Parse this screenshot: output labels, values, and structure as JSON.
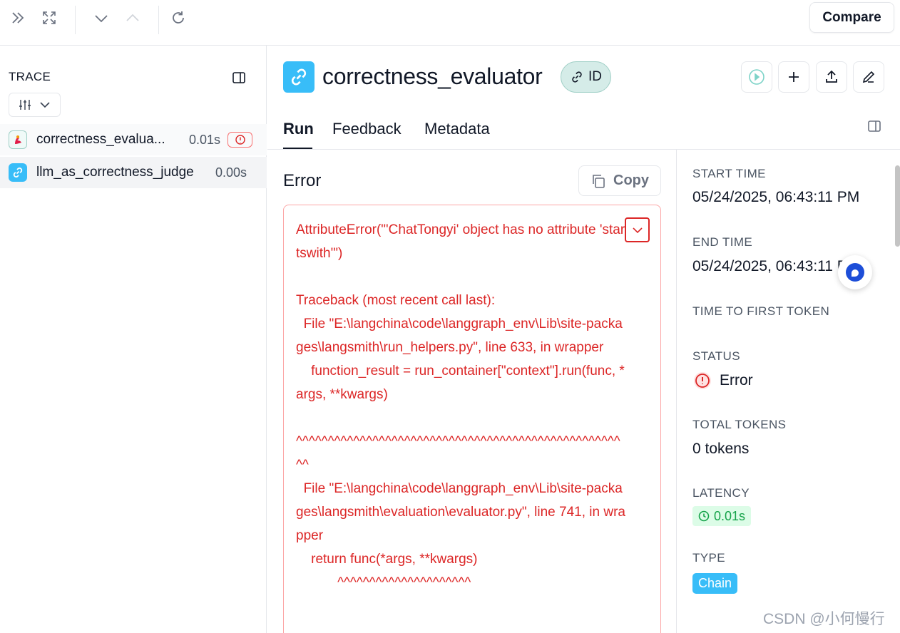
{
  "toolbar": {
    "compare_label": "Compare"
  },
  "trace_panel": {
    "title": "TRACE",
    "rows": [
      {
        "name": "correctness_evalua...",
        "duration": "0.01s",
        "icon": "bird-icon",
        "has_error": true
      },
      {
        "name": "llm_as_correctness_judge",
        "duration": "0.00s",
        "icon": "link-icon",
        "has_error": false
      }
    ]
  },
  "run": {
    "title": "correctness_evaluator",
    "id_badge": "ID",
    "tabs": [
      "Run",
      "Feedback",
      "Metadata"
    ],
    "active_tab": "Run"
  },
  "error_panel": {
    "heading": "Error",
    "copy_label": "Copy",
    "text": "AttributeError(\"'ChatTongyi' object has no attribute 'startswith'\")\n\nTraceback (most recent call last):\n  File \"E:\\langchina\\code\\langgraph_env\\Lib\\site-packages\\langsmith\\run_helpers.py\", line 633, in wrapper\n    function_result = run_container[\"context\"].run(func, *args, **kwargs)\n\n^^^^^^^^^^^^^^^^^^^^^^^^^^^^^^^^^^^^^^^^^^^^^^^^^^^^^\n  File \"E:\\langchina\\code\\langgraph_env\\Lib\\site-packages\\langsmith\\evaluation\\evaluator.py\", line 741, in wrapper\n    return func(*args, **kwargs)\n           ^^^^^^^^^^^^^^^^^^^^^"
  },
  "meta": {
    "start_time_label": "START TIME",
    "start_time": "05/24/2025, 06:43:11 PM",
    "end_time_label": "END TIME",
    "end_time": "05/24/2025, 06:43:11 PM",
    "ttft_label": "TIME TO FIRST TOKEN",
    "status_label": "STATUS",
    "status": "Error",
    "total_tokens_label": "TOTAL TOKENS",
    "total_tokens": "0 tokens",
    "latency_label": "LATENCY",
    "latency": "0.01s",
    "type_label": "TYPE",
    "type": "Chain"
  },
  "watermark": "CSDN @小何慢行",
  "colors": {
    "error": "#dc2626",
    "accent_blue": "#38bdf8",
    "success": "#16a34a"
  }
}
